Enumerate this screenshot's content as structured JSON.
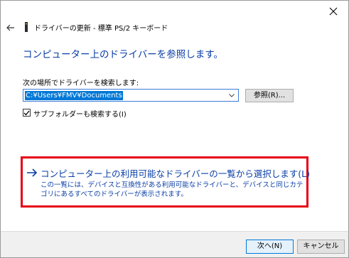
{
  "window": {
    "title": "ドライバーの更新 - 標準 PS/2 キーボード"
  },
  "heading": "コンピューター上のドライバーを参照します。",
  "search": {
    "label": "次の場所でドライバーを検索します:",
    "path_value": "C:¥Users¥FMV¥Documents",
    "browse_label": "参照(R)..."
  },
  "subfolder": {
    "label": "サブフォルダーも検索する(I)",
    "checked": true
  },
  "pick": {
    "link_text": "コンピューター上の利用可能なドライバーの一覧から選択します(L)",
    "description": "この一覧には、デバイスと互換性がある利用可能なドライバーと、デバイスと同じカテゴリにあるすべてのドライバーが表示されます。"
  },
  "footer": {
    "next_label": "次へ(N)",
    "cancel_label": "キャンセル"
  },
  "icons": {
    "close": "close-icon",
    "back": "back-arrow-icon",
    "device": "keyboard-device-icon",
    "dropdown": "chevron-down-icon",
    "check": "checkmark-icon",
    "link_arrow": "right-arrow-icon"
  },
  "colors": {
    "link_blue": "#0a3ea6",
    "highlight_red": "#e60012",
    "selection_blue": "#0078d7"
  }
}
